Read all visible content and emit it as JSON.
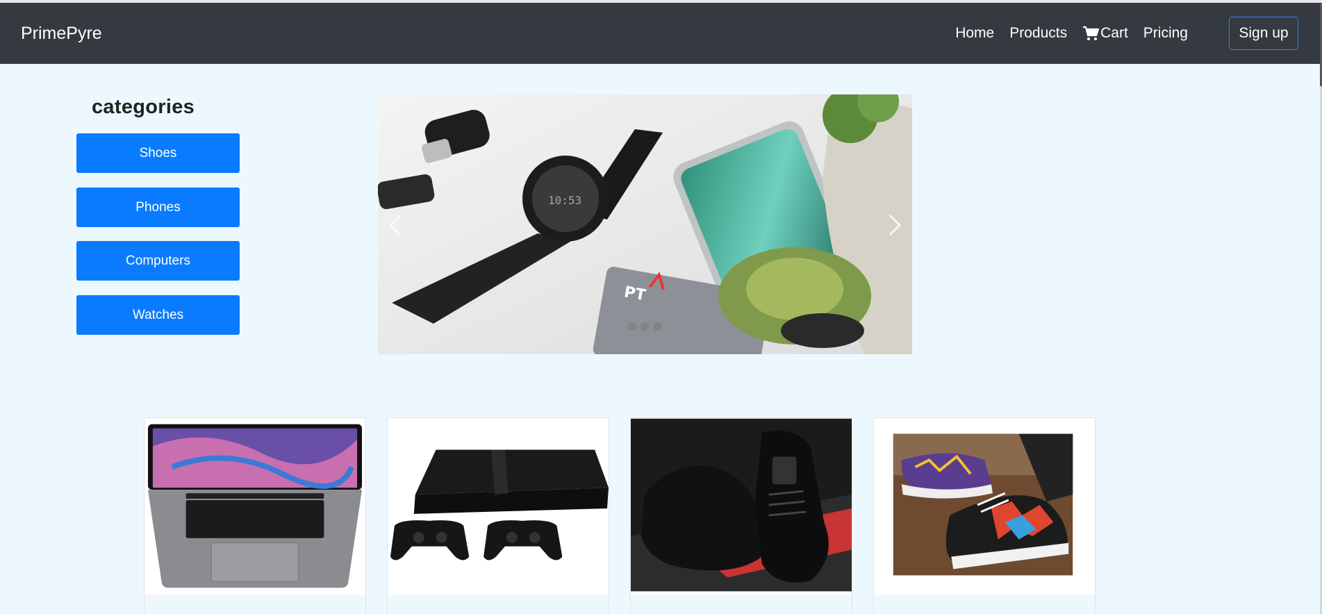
{
  "navbar": {
    "brand": "PrimePyre",
    "links": [
      "Home",
      "Products",
      "Cart",
      "Pricing"
    ],
    "signup": "Sign up"
  },
  "sidebar": {
    "title": "categories",
    "items": [
      "Shoes",
      "Phones",
      "Computers",
      "Watches"
    ]
  },
  "colors": {
    "navbar": "#343a40",
    "accent": "#0a7bff",
    "page_bg": "#ecf8fe"
  },
  "carousel": {
    "slide_count": 3,
    "prev_icon": "chevron-left-icon",
    "next_icon": "chevron-right-icon"
  },
  "products": [
    {
      "image": "laptop"
    },
    {
      "image": "game-console"
    },
    {
      "image": "black-sneakers"
    },
    {
      "image": "patterned-sneakers"
    }
  ]
}
